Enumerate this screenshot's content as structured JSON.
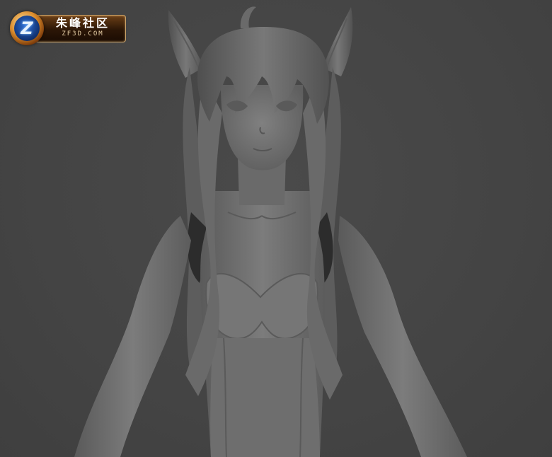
{
  "viewport": {
    "background_color": "#454545",
    "model_color": "#747474",
    "subject": "grey-shaded-character-model"
  },
  "watermark": {
    "badge_letter": "Z",
    "title": "朱峰社区",
    "subtitle": "ZF3D.COM"
  }
}
